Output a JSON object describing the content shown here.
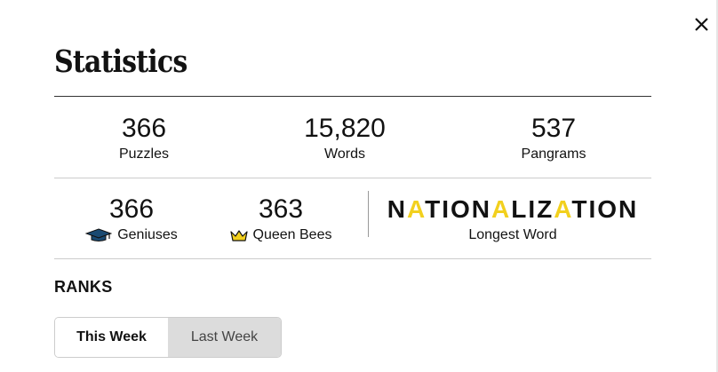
{
  "title": "Statistics",
  "close_icon": "close-icon",
  "summary": [
    {
      "value": "366",
      "label": "Puzzles"
    },
    {
      "value": "15,820",
      "label": "Words"
    },
    {
      "value": "537",
      "label": "Pangrams"
    }
  ],
  "achievements": {
    "geniuses": {
      "value": "366",
      "label": "Geniuses",
      "icon": "graduation-cap-icon"
    },
    "queen_bees": {
      "value": "363",
      "label": "Queen Bees",
      "icon": "crown-icon"
    }
  },
  "longest_word": {
    "word": "NATIONALIZATION",
    "segments": [
      {
        "text": "N",
        "highlight": false
      },
      {
        "text": "A",
        "highlight": true
      },
      {
        "text": "TION",
        "highlight": false
      },
      {
        "text": "A",
        "highlight": true
      },
      {
        "text": "LIZ",
        "highlight": false
      },
      {
        "text": "A",
        "highlight": true
      },
      {
        "text": "TION",
        "highlight": false
      }
    ],
    "highlight_color": "#f2d01e",
    "label": "Longest Word"
  },
  "ranks": {
    "heading": "RANKS",
    "tabs": [
      {
        "label": "This Week",
        "active": true
      },
      {
        "label": "Last Week",
        "active": false
      }
    ]
  },
  "colors": {
    "accent_yellow": "#f2d01e",
    "tab_inactive_bg": "#dcdcdc",
    "text": "#121212"
  }
}
